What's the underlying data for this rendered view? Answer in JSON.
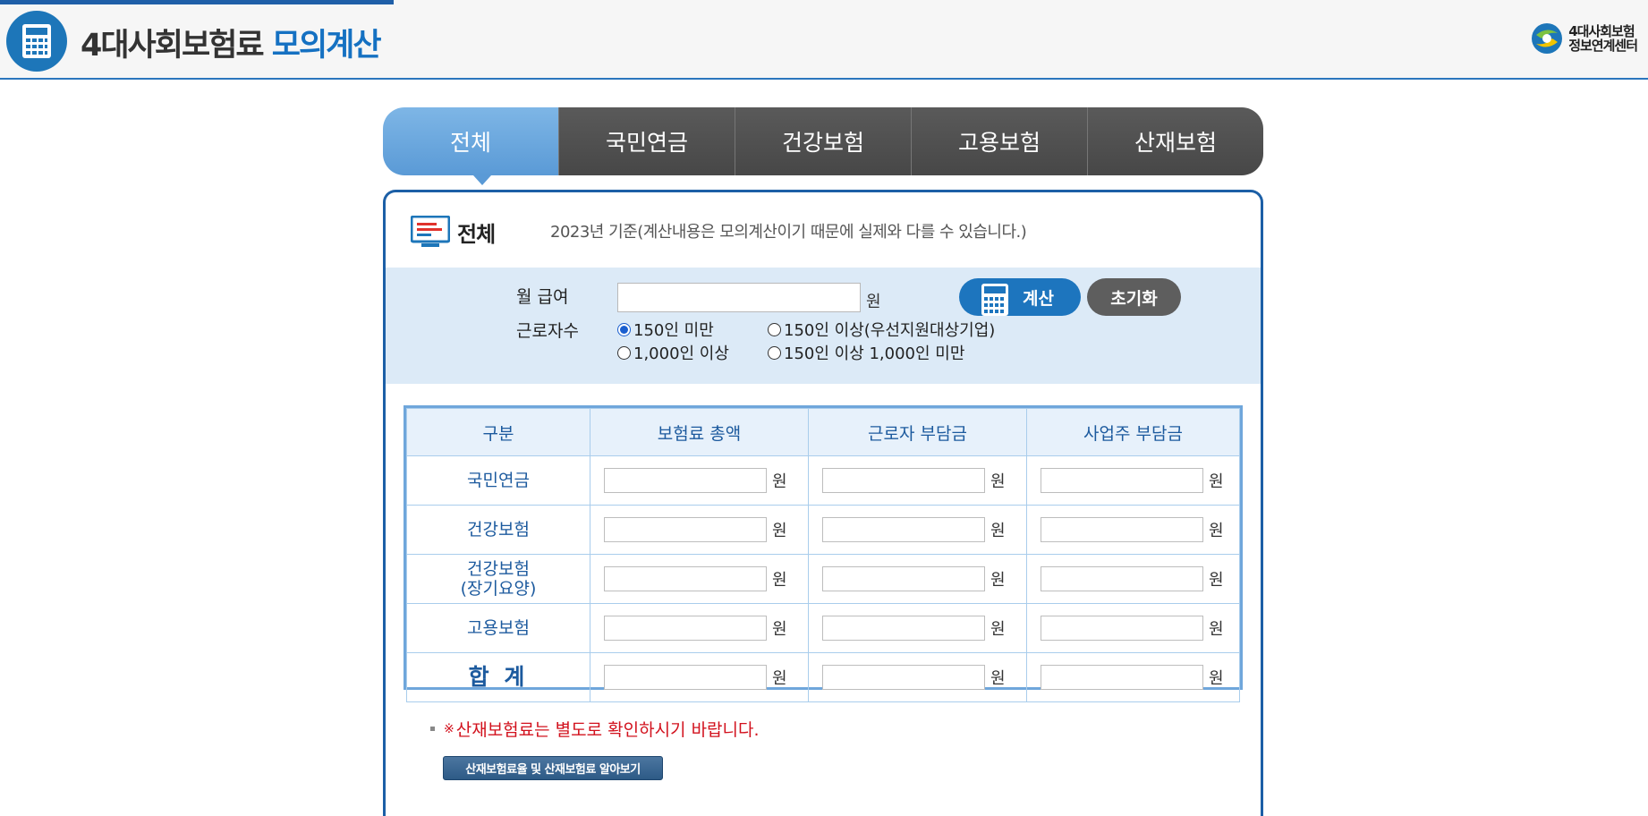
{
  "header": {
    "title_part1": "4대사회보험료",
    "title_part2": "모의계산",
    "brand_line1": "4대사회보험",
    "brand_line2": "정보연계센터"
  },
  "tabs": [
    {
      "label": "전체",
      "active": true
    },
    {
      "label": "국민연금",
      "active": false
    },
    {
      "label": "건강보험",
      "active": false
    },
    {
      "label": "고용보험",
      "active": false
    },
    {
      "label": "산재보험",
      "active": false
    }
  ],
  "section": {
    "title": "전체",
    "note": "2023년 기준(계산내용은 모의계산이기 때문에 실제와 다를 수 있습니다.)"
  },
  "form": {
    "salary_label": "월 급여",
    "salary_value": "",
    "unit": "원",
    "workers_label": "근로자수",
    "calc_button": "계산",
    "reset_button": "초기화",
    "radio_options": [
      {
        "label": "150인 미만",
        "checked": true
      },
      {
        "label": "150인 이상(우선지원대상기업)",
        "checked": false
      },
      {
        "label": "1,000인 이상",
        "checked": false
      },
      {
        "label": "150인 이상 1,000인 미만",
        "checked": false
      }
    ]
  },
  "table": {
    "headers": [
      "구분",
      "보험료 총액",
      "근로자 부담금",
      "사업주 부담금"
    ],
    "rows": [
      {
        "label": "국민연금",
        "values": [
          "",
          "",
          ""
        ]
      },
      {
        "label": "건강보험",
        "values": [
          "",
          "",
          ""
        ]
      },
      {
        "label": "건강보험",
        "label2": "(장기요양)",
        "values": [
          "",
          "",
          ""
        ]
      },
      {
        "label": "고용보험",
        "values": [
          "",
          "",
          ""
        ]
      },
      {
        "label": "합   계",
        "values": [
          "",
          "",
          ""
        ]
      }
    ],
    "unit": "원"
  },
  "notice": {
    "mark": "※",
    "text": "산재보험료는 별도로 확인하시기 바랍니다.",
    "link_button": "산재보험료율 및 산재보험료 알아보기"
  },
  "colors": {
    "accent_blue": "#1d75be",
    "tab_active": "#5a9ad6",
    "tab_inactive": "#4f4f4f",
    "notice_red": "#d2111d"
  }
}
